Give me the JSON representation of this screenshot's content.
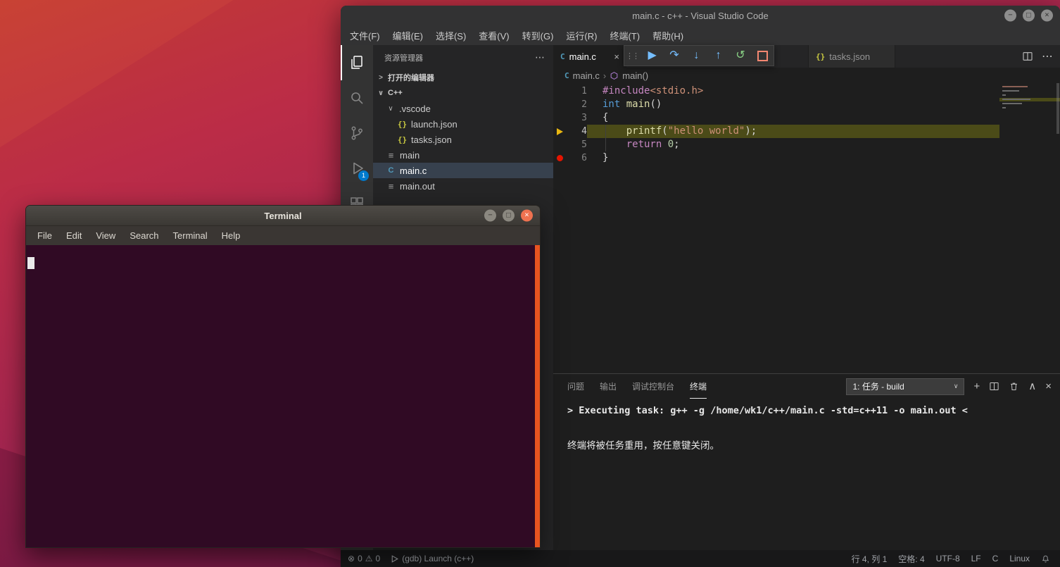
{
  "icons": {
    "drag_handle": "⋮⋮",
    "continue": "▶",
    "step_over": "↷",
    "step_into": "↓",
    "step_out": "↑",
    "restart": "↺",
    "more": "⋯",
    "dropdown_chevron": "∨",
    "panel_maximize": "∧",
    "close": "×",
    "plus": "+",
    "error": "⊗",
    "warning": "⚠",
    "chevron_collapsed": ">",
    "chevron_expanded": "∨",
    "breadcrumb_sep": "›",
    "json_braces": "{}",
    "c_letter": "C",
    "file_lines": "≡"
  },
  "vscode": {
    "title": "main.c - c++ - Visual Studio Code",
    "window_controls": {
      "minimize": "−",
      "maximize": "□",
      "close": "×"
    },
    "menu": {
      "items": [
        "文件(F)",
        "编辑(E)",
        "选择(S)",
        "查看(V)",
        "转到(G)",
        "运行(R)",
        "终端(T)",
        "帮助(H)"
      ]
    },
    "activity_badge": "1",
    "sidebar": {
      "title": "资源管理器",
      "open_editors": "打开的编辑器",
      "root": "C++",
      "items": {
        "vscode_folder": ".vscode",
        "launch": "launch.json",
        "tasks": "tasks.json",
        "main": "main",
        "mainc": "main.c",
        "mainout": "main.out"
      }
    },
    "tabs": {
      "tab1": "main.c",
      "tab2": "tasks.json"
    },
    "breadcrumb": {
      "file": "main.c",
      "symbol": "main()"
    },
    "code": {
      "lines": [
        {
          "n": "1",
          "s": [
            "#include",
            "<stdio.h>"
          ]
        },
        {
          "n": "2",
          "s": [
            "int",
            " ",
            "main",
            "()"
          ]
        },
        {
          "n": "3",
          "s": [
            "{"
          ]
        },
        {
          "n": "4",
          "s": [
            "    ",
            "printf",
            "(",
            "\"hello world\"",
            ");"
          ]
        },
        {
          "n": "5",
          "s": [
            "    ",
            "return",
            " ",
            "0",
            ";"
          ]
        },
        {
          "n": "6",
          "s": [
            "}"
          ]
        }
      ]
    },
    "panel": {
      "tabs": {
        "problems": "问题",
        "output": "输出",
        "debug_console": "调试控制台",
        "terminal": "终端"
      },
      "task_dropdown": "1: 任务 - build",
      "output_line1": "> Executing task: g++ -g /home/wk1/c++/main.c -std=c++11 -o main.out <",
      "output_line2": "终端将被任务重用，按任意键关闭。"
    },
    "statusbar": {
      "errors": "0",
      "warnings": "0",
      "debug_target": "(gdb) Launch (c++)",
      "cursor_position": "行 4, 列 1",
      "indent": "空格: 4",
      "encoding": "UTF-8",
      "eol": "LF",
      "language": "C",
      "os": "Linux"
    }
  },
  "terminal": {
    "title": "Terminal",
    "window_controls": {
      "minimize": "−",
      "maximize": "□",
      "close": "×"
    },
    "menu": {
      "items": [
        "File",
        "Edit",
        "View",
        "Search",
        "Terminal",
        "Help"
      ]
    }
  },
  "colors": {
    "accent": "#007acc",
    "debug_line_highlight": "#4b4b18",
    "terminal_background": "#300a24",
    "ubuntu_orange": "#e95420",
    "breakpoint_red": "#e51400"
  }
}
